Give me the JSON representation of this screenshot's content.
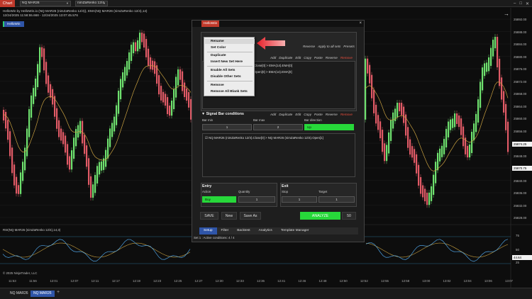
{
  "topbar": {
    "chart_tab": "Chart",
    "instrument": "NQ MAR26",
    "bar_type": "nimZaRenko 12/4"
  },
  "chart": {
    "info_line1": "HelloWin by HelloWin.io (NQ MAR26 (nimZaRenko 12/4)), EMA(NQ MAR26 (nimZaRenko 12/4),14)",
    "info_line2": "12/24/2025 11:58:55.668 - 12/24/2025 13:07:45.576",
    "hellowin_button": "HelloWin",
    "price_labels": [
      "25892.00",
      "25888.00",
      "25884.00",
      "25880.00",
      "25876.00",
      "25872.00",
      "25868.00",
      "25864.00",
      "25860.00",
      "25856.00",
      "25852.00",
      "25848.00",
      "25844.00",
      "25840.00",
      "25836.00",
      "25832.00",
      "25828.00"
    ],
    "price_badges": [
      {
        "text": "25874.25",
        "color": "#f2f2f2"
      },
      {
        "text": "25870.75",
        "color": "#f2f2f2"
      }
    ],
    "time_labels": [
      "11:53",
      "11:56",
      "12:01",
      "12:07",
      "12:11",
      "12:17",
      "12:19",
      "12:23",
      "12:25",
      "12:27",
      "12:30",
      "12:33",
      "12:36",
      "12:41",
      "12:46",
      "12:48",
      "12:50",
      "12:52",
      "12:55",
      "12:58",
      "13:00",
      "13:02",
      "13:04",
      "13:06",
      "13:07"
    ],
    "rsi_title": "RSI(NQ MAR26 (nimZaRenko 12/4),14,3)",
    "rsi_labels": [
      "75",
      "50",
      "25"
    ],
    "rsi_badge": "44.64",
    "copyright": "© 2025 NinjaTrader, LLC",
    "colors": {
      "up": "#6ee06e",
      "down": "#e05a66",
      "ema": "#c8a040",
      "rsi": "#4da0e0",
      "rsi_signal": "#c8a040"
    }
  },
  "window": {
    "title": "HelloWin",
    "close": "×",
    "top_actions": [
      "Reverse",
      "Apply to all sets",
      "Presets"
    ],
    "set_actions": [
      "Add",
      "Duplicate",
      "Edit",
      "Copy",
      "Paste",
      "Reverse",
      "Remove"
    ],
    "conditions": [
      "Close[0] > EMA(14).EMA[0]",
      "Open[0] > EMA(14).EMA[0]"
    ],
    "signal_section": {
      "title": "Signal Bar conditions",
      "actions": [
        "Add",
        "Duplicate",
        "Edit",
        "Copy",
        "Paste",
        "Reverse",
        "Remove"
      ],
      "bar_min_label": "Bar min",
      "bar_min": "1",
      "bar_max_label": "Bar max",
      "bar_max": "2",
      "bar_direction_label": "Bar direction",
      "bar_direction": "Up",
      "condition": "NQ MAR26 (nimZaRenko 12/4).Close[0] > NQ MAR26 (nimZaRenko 12/4).Open[1]"
    },
    "entry": {
      "title": "Entry",
      "action_label": "Action",
      "action_value": "Buy",
      "quantity_label": "Quantity",
      "quantity_value": "1"
    },
    "exit": {
      "title": "Exit",
      "stop_label": "Stop",
      "stop_value": "1",
      "target_label": "Target",
      "target_value": "1"
    },
    "buttons": {
      "save": "SAVE",
      "new": "New",
      "save_as": "Save As",
      "analyze": "ANALYZE",
      "count": "50"
    },
    "tabs": [
      "Setup",
      "Filter",
      "Backtest",
      "Analytics",
      "Template Manager"
    ],
    "status": "Set 1 : Active conditions: 4 / 4"
  },
  "context_menu": {
    "items": [
      "Rename",
      "Set Color",
      "Duplicate",
      "Insert New Set Here",
      "Enable All Sets",
      "Disable Other Sets",
      "Remove",
      "Remove All Blank Sets"
    ]
  },
  "bottom_tabs": [
    "NQ MAR26",
    "NQ MAR26"
  ]
}
